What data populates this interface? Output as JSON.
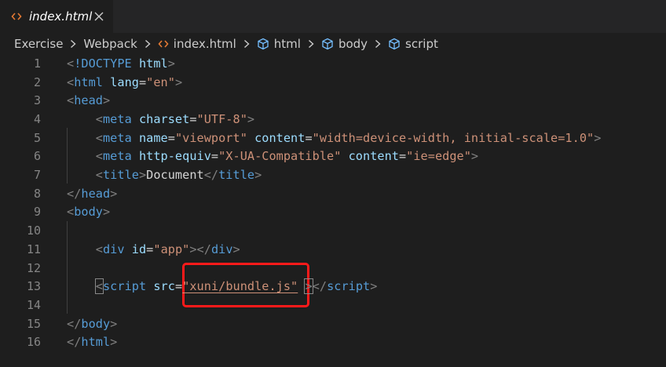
{
  "tab": {
    "label": "index.html",
    "icon": "html-brackets-icon",
    "close_icon": "close-icon"
  },
  "breadcrumb": {
    "items": [
      {
        "label": "Exercise",
        "icon": null
      },
      {
        "label": "Webpack",
        "icon": null
      },
      {
        "label": "index.html",
        "icon": "html-brackets-icon"
      },
      {
        "label": "html",
        "icon": "cube-icon"
      },
      {
        "label": "body",
        "icon": "cube-icon"
      },
      {
        "label": "script",
        "icon": "cube-icon"
      }
    ]
  },
  "editor": {
    "line_numbers": [
      "1",
      "2",
      "3",
      "4",
      "5",
      "6",
      "7",
      "8",
      "9",
      "10",
      "11",
      "12",
      "13",
      "14",
      "15",
      "16"
    ],
    "lines": [
      [
        [
          "punc",
          "<"
        ],
        [
          "doc",
          "!DOCTYPE"
        ],
        [
          "text",
          " "
        ],
        [
          "attr",
          "html"
        ],
        [
          "punc",
          ">"
        ]
      ],
      [
        [
          "punc",
          "<"
        ],
        [
          "tag",
          "html"
        ],
        [
          "text",
          " "
        ],
        [
          "attr",
          "lang"
        ],
        [
          "eq",
          "="
        ],
        [
          "str",
          "\"en\""
        ],
        [
          "punc",
          ">"
        ]
      ],
      [
        [
          "punc",
          "<"
        ],
        [
          "tag",
          "head"
        ],
        [
          "punc",
          ">"
        ]
      ],
      [
        [
          "text",
          "    "
        ],
        [
          "punc",
          "<"
        ],
        [
          "tag",
          "meta"
        ],
        [
          "text",
          " "
        ],
        [
          "attr",
          "charset"
        ],
        [
          "eq",
          "="
        ],
        [
          "str",
          "\"UTF-8\""
        ],
        [
          "punc",
          ">"
        ]
      ],
      [
        [
          "text",
          "    "
        ],
        [
          "punc",
          "<"
        ],
        [
          "tag",
          "meta"
        ],
        [
          "text",
          " "
        ],
        [
          "attr",
          "name"
        ],
        [
          "eq",
          "="
        ],
        [
          "str",
          "\"viewport\""
        ],
        [
          "text",
          " "
        ],
        [
          "attr",
          "content"
        ],
        [
          "eq",
          "="
        ],
        [
          "str",
          "\"width=device-width, initial-scale=1.0\""
        ],
        [
          "punc",
          ">"
        ]
      ],
      [
        [
          "text",
          "    "
        ],
        [
          "punc",
          "<"
        ],
        [
          "tag",
          "meta"
        ],
        [
          "text",
          " "
        ],
        [
          "attr",
          "http-equiv"
        ],
        [
          "eq",
          "="
        ],
        [
          "str",
          "\"X-UA-Compatible\""
        ],
        [
          "text",
          " "
        ],
        [
          "attr",
          "content"
        ],
        [
          "eq",
          "="
        ],
        [
          "str",
          "\"ie=edge\""
        ],
        [
          "punc",
          ">"
        ]
      ],
      [
        [
          "text",
          "    "
        ],
        [
          "punc",
          "<"
        ],
        [
          "tag",
          "title"
        ],
        [
          "punc",
          ">"
        ],
        [
          "text",
          "Document"
        ],
        [
          "punc",
          "</"
        ],
        [
          "tag",
          "title"
        ],
        [
          "punc",
          ">"
        ]
      ],
      [
        [
          "punc",
          "</"
        ],
        [
          "tag",
          "head"
        ],
        [
          "punc",
          ">"
        ]
      ],
      [
        [
          "punc",
          "<"
        ],
        [
          "tag",
          "body"
        ],
        [
          "punc",
          ">"
        ]
      ],
      [],
      [
        [
          "text",
          "    "
        ],
        [
          "punc",
          "<"
        ],
        [
          "tag",
          "div"
        ],
        [
          "text",
          " "
        ],
        [
          "attr",
          "id"
        ],
        [
          "eq",
          "="
        ],
        [
          "str",
          "\"app\""
        ],
        [
          "punc",
          "></"
        ],
        [
          "tag",
          "div"
        ],
        [
          "punc",
          ">"
        ]
      ],
      [],
      [
        [
          "text",
          "    "
        ],
        [
          "punchl",
          "<"
        ],
        [
          "tag",
          "script"
        ],
        [
          "text",
          " "
        ],
        [
          "attr",
          "src"
        ],
        [
          "eq",
          "="
        ],
        [
          "ustr",
          "\"xuni/bundle.js\""
        ],
        [
          "text",
          " "
        ],
        [
          "punchl",
          ">"
        ],
        [
          "punc",
          "</"
        ],
        [
          "tag",
          "script"
        ],
        [
          "punc",
          ">"
        ]
      ],
      [],
      [
        [
          "punc",
          "</"
        ],
        [
          "tag",
          "body"
        ],
        [
          "punc",
          ">"
        ]
      ],
      [
        [
          "punc",
          "</"
        ],
        [
          "tag",
          "html"
        ],
        [
          "punc",
          ">"
        ]
      ]
    ],
    "highlight_color": "#ff1a1a"
  },
  "colors": {
    "background": "#1e1e1e",
    "tab_bar": "#252526",
    "tag": "#569cd6",
    "attribute": "#9cdcfe",
    "string": "#ce9178",
    "punctuation": "#808080",
    "line_number": "#858585"
  }
}
